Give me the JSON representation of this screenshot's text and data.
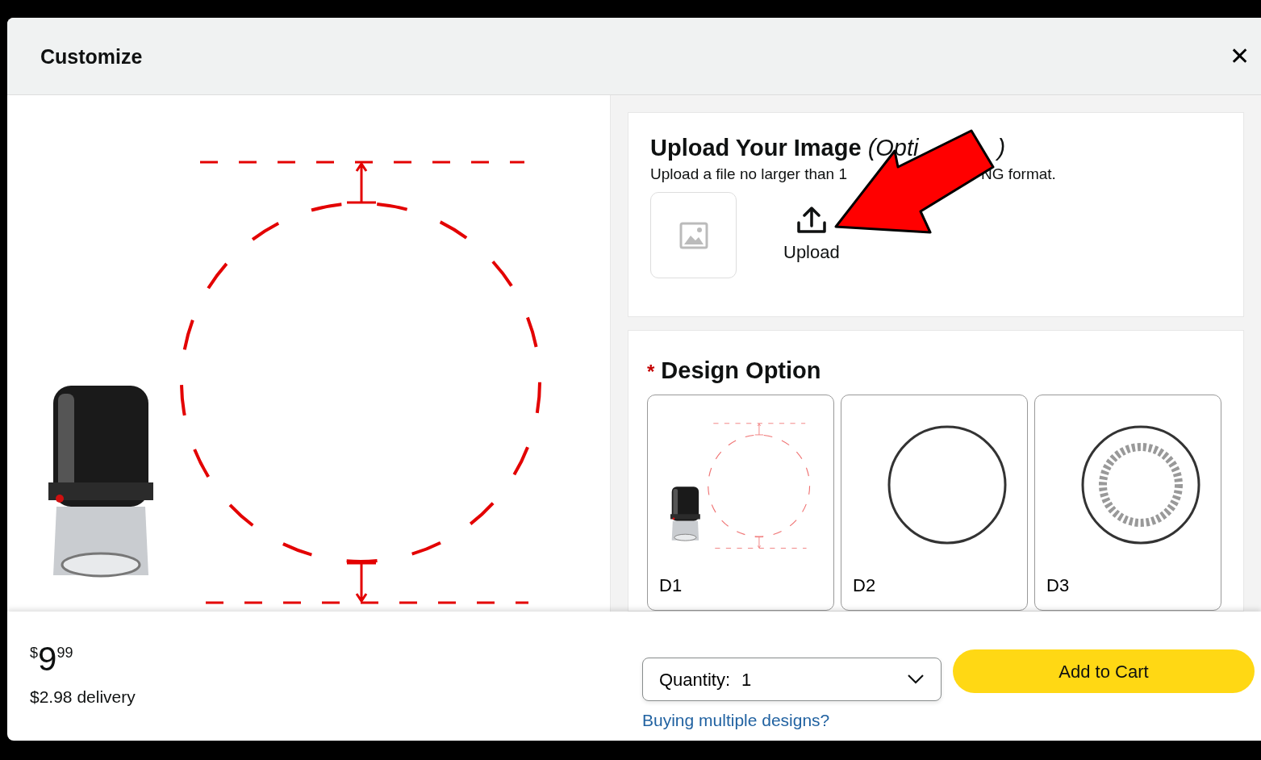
{
  "dialog": {
    "title": "Customize",
    "close": "✕"
  },
  "upload": {
    "title": "Upload Your Image",
    "title_suffix": "(Opti",
    "title_tail": ")",
    "hint_start": "Upload a file no larger than 1",
    "hint_end": "NG format.",
    "button": "Upload"
  },
  "design": {
    "required_mark": "*",
    "title": "Design Option",
    "options": [
      {
        "label": "D1",
        "kind": "diagram",
        "selected": false
      },
      {
        "label": "D2",
        "kind": "circle",
        "selected": false
      },
      {
        "label": "D3",
        "kind": "seal",
        "selected": false
      }
    ]
  },
  "footer": {
    "price_symbol": "$",
    "price_whole": "9",
    "price_fraction": "99",
    "delivery": "$2.98 delivery",
    "quantity_label": "Quantity:",
    "quantity_value": "1",
    "multi_link": "Buying multiple designs?",
    "add_button": "Add to Cart"
  }
}
